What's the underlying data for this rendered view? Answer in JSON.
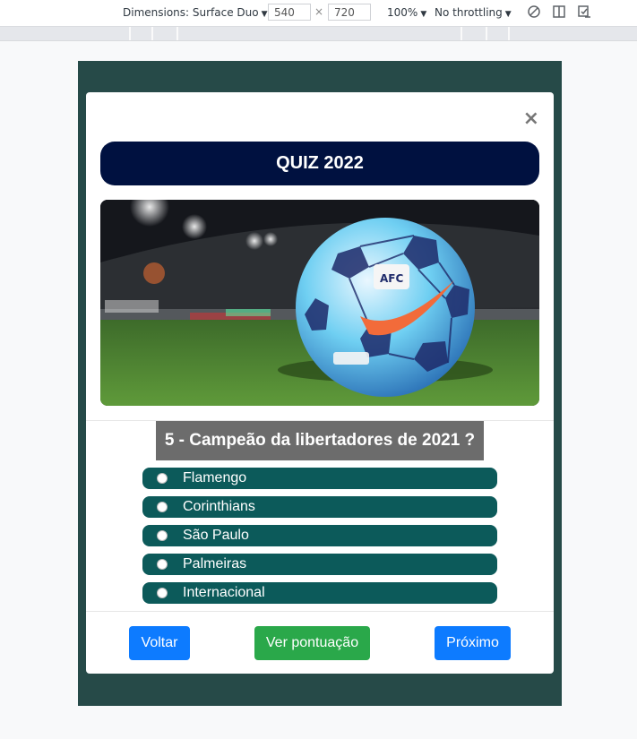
{
  "devtools": {
    "dimensions_label": "Dimensions: Surface Duo",
    "width": "540",
    "height": "720",
    "zoom": "100%",
    "throttling": "No throttling",
    "separator": "×",
    "icons": [
      "rotate-icon",
      "dual-screen-icon",
      "sensor-icon"
    ]
  },
  "quiz": {
    "close_symbol": "×",
    "title": "QUIZ 2022",
    "question": "5 - Campeão da libertadores de 2021 ?",
    "options": [
      "Flamengo",
      "Corinthians",
      "São Paulo",
      "Palmeiras",
      "Internacional"
    ],
    "buttons": {
      "back": "Voltar",
      "score": "Ver pontuação",
      "next": "Próximo"
    },
    "colors": {
      "title_bg": "#001140",
      "option_bg": "#0c5a5a",
      "question_bg": "#6c6c6c",
      "primary": "#0d7bff",
      "success": "#2aa84a",
      "page_bg": "#264a48"
    }
  }
}
